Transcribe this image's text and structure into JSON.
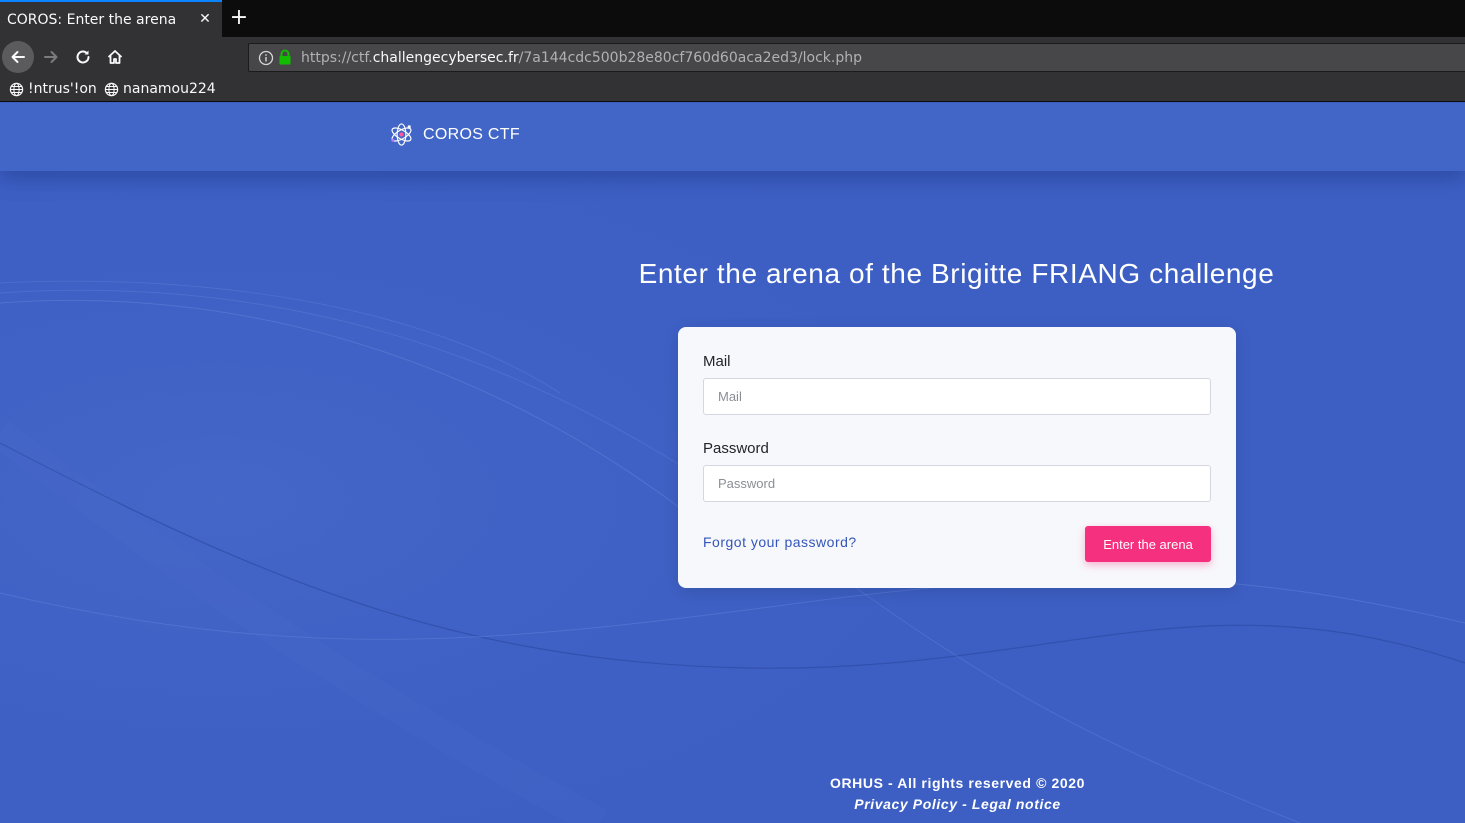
{
  "browser": {
    "tab_title": "COROS: Enter the arena",
    "tab_close_glyph": "✕",
    "new_tab_glyph": "+",
    "url_prefix": "https://ctf.",
    "url_host": "challengecybersec.fr",
    "url_path": "/7a144cdc500b28e80cf760d60aca2ed3/lock.php",
    "bookmarks": [
      {
        "label": "!ntrus'!on",
        "icon": "globe-icon"
      },
      {
        "label": "nanamou224",
        "icon": "globe-icon"
      }
    ]
  },
  "site": {
    "brand": "COROS CTF",
    "brand_icon": "atom-logo-icon",
    "headline": "Enter the arena of the Brigitte FRIANG challenge"
  },
  "form": {
    "mail_label": "Mail",
    "mail_placeholder": "Mail",
    "mail_value": "",
    "password_label": "Password",
    "password_placeholder": "Password",
    "password_value": "",
    "forgot_link": "Forgot your password?",
    "submit_label": "Enter the arena"
  },
  "footer": {
    "rights": "ORHUS - All rights reserved © 2020",
    "links": "Privacy Policy - Legal notice"
  },
  "colors": {
    "page_bg": "#3d5fc4",
    "header_bg": "#4166c8",
    "card_bg": "#f7f8fb",
    "button": "#f5317f",
    "link": "#3556b8"
  }
}
